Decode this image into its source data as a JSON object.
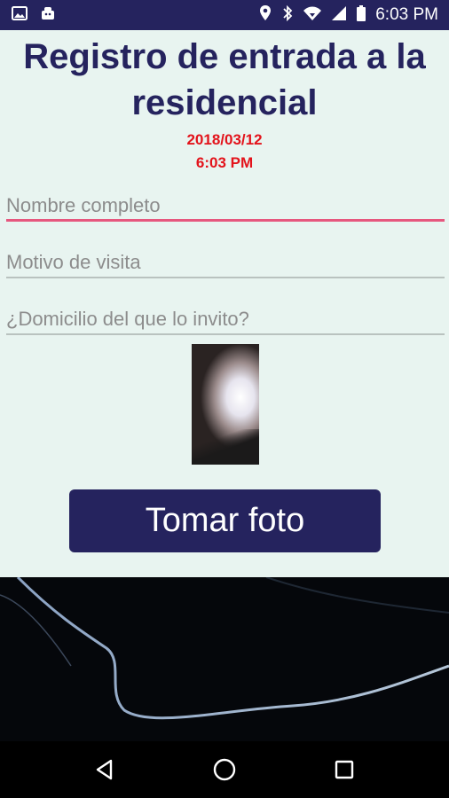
{
  "status_bar": {
    "time": "6:03 PM",
    "icons_left": [
      "image-icon",
      "android-icon"
    ],
    "icons_right": [
      "location-icon",
      "bluetooth-icon",
      "wifi-icon",
      "signal-icon",
      "battery-icon"
    ]
  },
  "header": {
    "title": "Registro de entrada a la residencial",
    "date": "2018/03/12",
    "time": "6:03 PM"
  },
  "form": {
    "name_placeholder": "Nombre completo",
    "reason_placeholder": "Motivo de visita",
    "address_placeholder": "¿Domicilio del que lo invito?",
    "name_value": "",
    "reason_value": "",
    "address_value": ""
  },
  "actions": {
    "take_photo_label": "Tomar foto"
  },
  "colors": {
    "primary": "#25235e",
    "accent": "#e3131b",
    "active_underline": "#e6577e",
    "background": "#e8f4f0"
  }
}
